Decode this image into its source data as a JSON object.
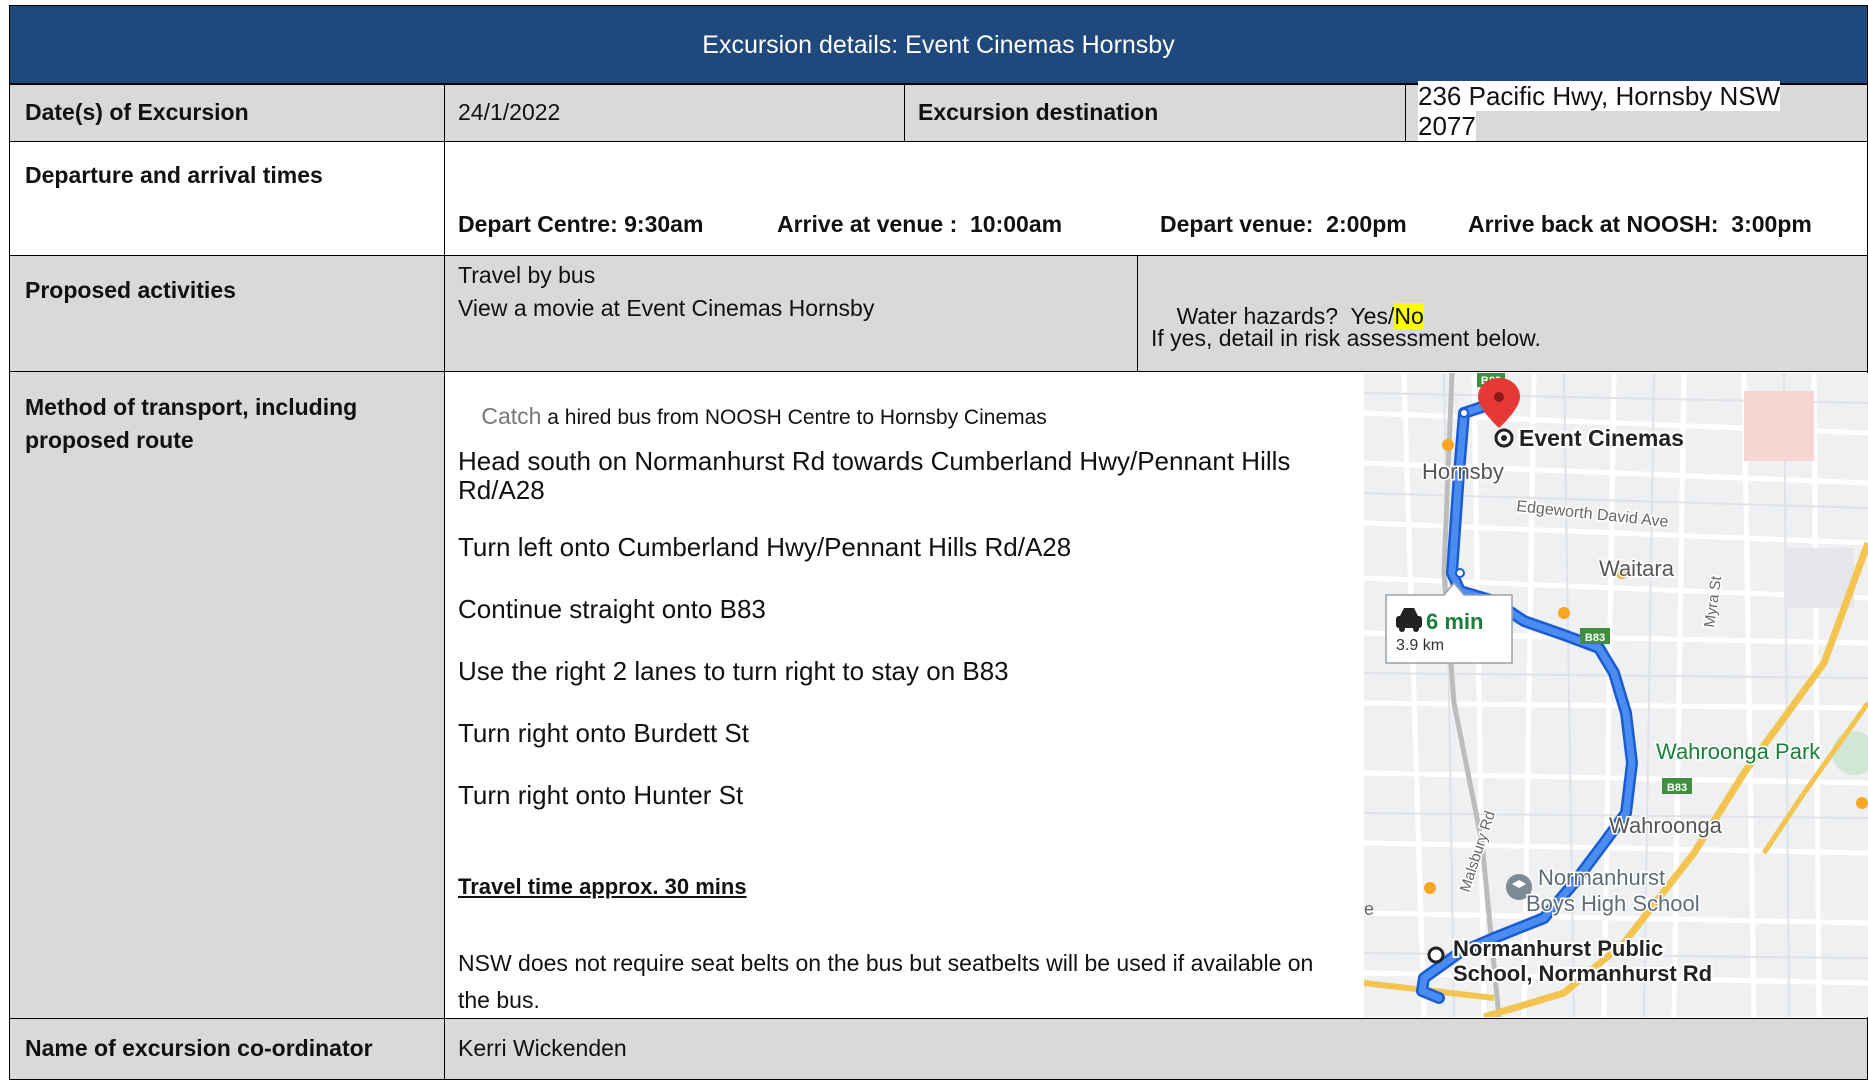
{
  "header": {
    "title": "Excursion details: Event Cinemas Hornsby"
  },
  "row_dates": {
    "label": "Date(s) of Excursion",
    "value": "24/1/2022",
    "dest_label": "Excursion destination",
    "dest_line1": "236 Pacific Hwy, Hornsby NSW",
    "dest_line2": "2077"
  },
  "row_times": {
    "label": "Departure and arrival times",
    "depart_centre": "Depart Centre: 9:30am",
    "arrive_venue": "Arrive at venue :  10:00am",
    "depart_venue": "Depart venue:  2:00pm",
    "arrive_back": "Arrive back at NOOSH:  3:00pm"
  },
  "row_activities": {
    "label": "Proposed activities",
    "line1": "Travel by bus",
    "line2": "View a movie at Event Cinemas Hornsby",
    "water_prefix": "Water hazards?  Yes/",
    "water_answer": "No",
    "water_note": "If yes, detail in risk assessment below."
  },
  "row_transport": {
    "label_line1": "Method of transport, including",
    "label_line2": "proposed route",
    "catch_word": "Catch",
    "catch_rest": " a hired bus from NOOSH Centre to Hornsby Cinemas",
    "steps": [
      "Head south on Normanhurst Rd towards Cumberland Hwy/Pennant Hills Rd/A28",
      "Turn left onto Cumberland Hwy/Pennant Hills Rd/A28",
      "Continue straight onto B83",
      "Use the right 2 lanes to turn right to stay on B83",
      "Turn right onto Burdett St",
      "Turn right onto Hunter St"
    ],
    "travel_time": "Travel time approx. 30 mins",
    "seatbelt_note": "NSW does not require seat belts on the bus but seatbelts will be used if available on the bus."
  },
  "map": {
    "dest_name": "Event Cinemas",
    "suburb_hornsby": "Hornsby",
    "street_edgeworth": "Edgeworth David Ave",
    "suburb_waitara": "Waitara",
    "street_myra": "Myra St",
    "duration": "6 min",
    "distance": "3.9 km",
    "road_b83": "B83",
    "park": "Wahroonga Park",
    "street_malsbury": "Malsbury Rd",
    "suburb_wahroonga": "Wahroonga",
    "school_boys_line1": "Normanhurst",
    "school_boys_line2": "Boys High School",
    "origin_line1": "Normanhurst Public",
    "origin_line2": "School, Normanhurst Rd",
    "edge_letter": "e"
  },
  "row_coordinator": {
    "label": "Name of excursion co-ordinator",
    "value": "Kerri Wickenden"
  }
}
